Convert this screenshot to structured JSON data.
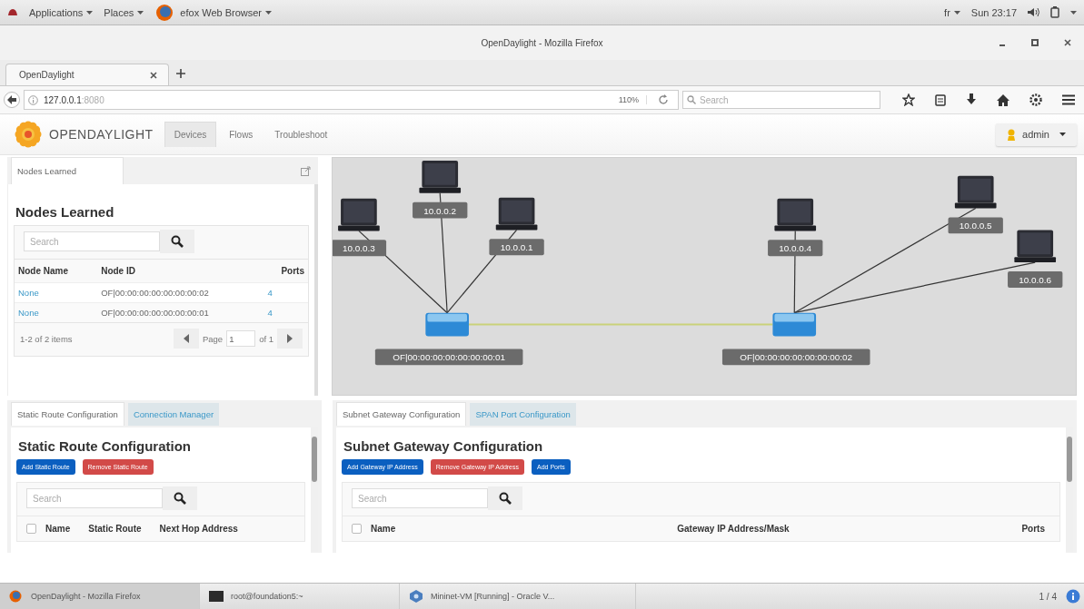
{
  "desktop_bar": {
    "menus": [
      "Applications",
      "Places"
    ],
    "app_menu": "efox Web Browser",
    "keyboard": "fr",
    "clock": "Sun 23:17"
  },
  "window": {
    "title": "OpenDaylight - Mozilla Firefox"
  },
  "browser_tabs": [
    {
      "label": "OpenDaylight",
      "selected": true
    }
  ],
  "address_bar": {
    "host": "127.0.0.1",
    "port": ":8080",
    "zoom": "110%",
    "search_placeholder": "Search"
  },
  "app": {
    "brand": "OPENDAYLIGHT",
    "nav": [
      {
        "label": "Devices",
        "selected": true
      },
      {
        "label": "Flows",
        "selected": false
      },
      {
        "label": "Troubleshoot",
        "selected": false
      }
    ],
    "user": "admin"
  },
  "nodes_panel": {
    "tabs": [
      {
        "label": "Nodes Learned",
        "selected": true
      }
    ],
    "title": "Nodes Learned",
    "search_placeholder": "Search",
    "columns": [
      "Node Name",
      "Node ID",
      "Ports"
    ],
    "rows": [
      [
        "None",
        "OF|00:00:00:00:00:00:00:02",
        "4"
      ],
      [
        "None",
        "OF|00:00:00:00:00:00:00:01",
        "4"
      ]
    ],
    "summary": "1-2 of 2 items",
    "page_label": "Page",
    "page": "1",
    "page_of": "of 1"
  },
  "topology": {
    "switches": [
      {
        "label": "OF|00:00:00:00:00:00:00:01",
        "hosts": [
          "10.0.0.3",
          "10.0.0.2",
          "10.0.0.1"
        ]
      },
      {
        "label": "OF|00:00:00:00:00:00:00:02",
        "hosts": [
          "10.0.0.4",
          "10.0.0.5",
          "10.0.0.6"
        ]
      }
    ]
  },
  "static_panel": {
    "tabs": [
      {
        "label": "Static Route Configuration",
        "selected": true
      },
      {
        "label": "Connection Manager",
        "selected": false
      }
    ],
    "title": "Static Route Configuration",
    "buttons": [
      {
        "label": "Add Static Route",
        "kind": "primary"
      },
      {
        "label": "Remove Static Route",
        "kind": "danger"
      }
    ],
    "search_placeholder": "Search",
    "select_all_checked": false,
    "columns": [
      "Name",
      "Static Route",
      "Next Hop Address"
    ]
  },
  "gateway_panel": {
    "tabs": [
      {
        "label": "Subnet Gateway Configuration",
        "selected": true
      },
      {
        "label": "SPAN Port Configuration",
        "selected": false
      }
    ],
    "title": "Subnet Gateway Configuration",
    "buttons": [
      {
        "label": "Add Gateway IP Address",
        "kind": "primary"
      },
      {
        "label": "Remove Gateway IP Address",
        "kind": "danger"
      },
      {
        "label": "Add Ports",
        "kind": "primary"
      }
    ],
    "search_placeholder": "Search",
    "select_all_checked": false,
    "columns": [
      "Name",
      "Gateway IP Address/Mask",
      "Ports"
    ]
  },
  "taskbar": {
    "items": [
      {
        "label": "OpenDaylight - Mozilla Firefox",
        "kind": "browser",
        "selected": true
      },
      {
        "label": "root@foundation5:~",
        "kind": "terminal",
        "selected": false
      },
      {
        "label": "Mininet-VM [Running] - Oracle V...",
        "kind": "vm",
        "selected": false
      }
    ],
    "workspace": "1 / 4"
  }
}
